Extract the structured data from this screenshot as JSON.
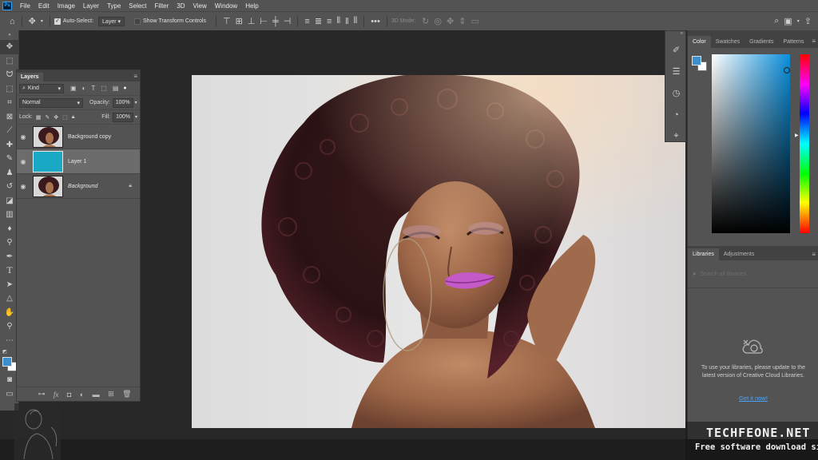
{
  "menubar": {
    "app_logo": "Ps",
    "items": [
      "File",
      "Edit",
      "Image",
      "Layer",
      "Type",
      "Select",
      "Filter",
      "3D",
      "View",
      "Window",
      "Help"
    ]
  },
  "options_bar": {
    "auto_select_label": "Auto-Select:",
    "auto_select_target": "Layer",
    "show_transform_label": "Show Transform Controls",
    "three_d_mode_label": "3D Mode:"
  },
  "layers_panel": {
    "tab_label": "Layers",
    "filter_kind": "Kind",
    "blend_mode": "Normal",
    "opacity_label": "Opacity:",
    "opacity_value": "100%",
    "lock_label": "Lock:",
    "fill_label": "Fill:",
    "fill_value": "100%",
    "layers": [
      {
        "name": "Background copy",
        "thumbnail": "portrait"
      },
      {
        "name": "Layer 1",
        "thumbnail": "cyan-fill",
        "selected": true,
        "color": "#19a9c5"
      },
      {
        "name": "Background",
        "thumbnail": "portrait",
        "locked": true
      }
    ],
    "footer_icons": [
      "link-icon",
      "fx-icon",
      "mask-icon",
      "adjustment-icon",
      "folder-icon",
      "new-layer-icon",
      "trash-icon"
    ],
    "fx_label": "fx"
  },
  "color_panel": {
    "tabs": [
      "Color",
      "Swatches",
      "Gradients",
      "Patterns"
    ],
    "active_tab": "Color",
    "foreground_color": "#3a8fd0",
    "background_color": "#ffffff"
  },
  "libraries_panel": {
    "tabs": [
      "Libraries",
      "Adjustments"
    ],
    "active_tab": "Libraries",
    "search_placeholder": "Search all libraries",
    "message": "To use your libraries, please update to the latest version of Creative Cloud Libraries.",
    "link_label": "Get it now!"
  },
  "watermark": {
    "title": "TECHFEONE.NET",
    "subtitle": "Free software download site"
  },
  "colors": {
    "panel_bg": "#535353",
    "canvas_bg": "#282828",
    "accent": "#31a8ff",
    "link": "#4aa5ff"
  }
}
